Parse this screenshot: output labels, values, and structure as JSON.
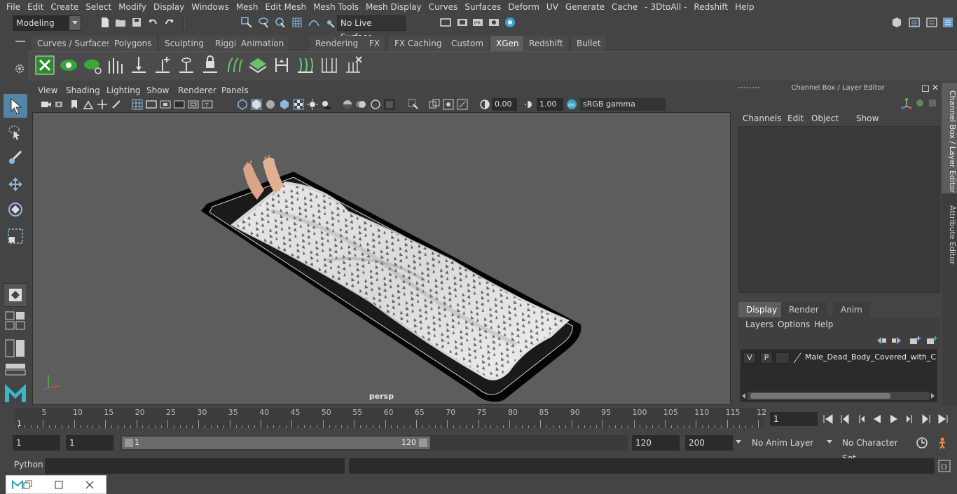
{
  "menu": [
    "File",
    "Edit",
    "Create",
    "Select",
    "Modify",
    "Display",
    "Windows",
    "Mesh",
    "Edit Mesh",
    "Mesh Tools",
    "Mesh Display",
    "Curves",
    "Surfaces",
    "Deform",
    "UV",
    "Generate",
    "Cache",
    "- 3DtoAll -",
    "Redshift",
    "Help"
  ],
  "status": {
    "mode": "Modeling",
    "live_surface": "No Live Surface"
  },
  "shelf_tabs": [
    "Curves / Surfaces",
    "Polygons",
    "Sculpting",
    "Rigging",
    "Animation",
    "Rendering",
    "FX",
    "FX Caching",
    "Custom",
    "XGen",
    "Redshift",
    "Bullet"
  ],
  "shelf_active": "XGen",
  "viewport": {
    "menus": [
      "View",
      "Shading",
      "Lighting",
      "Show",
      "Renderer",
      "Panels"
    ],
    "exposure": "0.00",
    "gamma": "1.00",
    "color_space": "sRGB gamma",
    "camera": "persp"
  },
  "channel_box": {
    "title": "Channel Box / Layer Editor",
    "menus": [
      "Channels",
      "Edit",
      "Object",
      "Show"
    ],
    "layer_tabs": [
      "Display",
      "Render",
      "Anim"
    ],
    "layer_menus": [
      "Layers",
      "Options",
      "Help"
    ],
    "layer": {
      "v": "V",
      "p": "P",
      "name": "Male_Dead_Body_Covered_with_Clot"
    }
  },
  "side_tabs": [
    "Channel Box / Layer Editor",
    "Attribute Editor"
  ],
  "timeline": {
    "ticks": [
      "5",
      "10",
      "15",
      "20",
      "25",
      "30",
      "35",
      "40",
      "45",
      "50",
      "55",
      "60",
      "65",
      "70",
      "75",
      "80",
      "85",
      "90",
      "95",
      "100",
      "105",
      "110",
      "115",
      "12"
    ],
    "start_marker": "1",
    "current_frame": "1"
  },
  "range": {
    "start": "1",
    "playback_start": "1",
    "slider_start": "1",
    "slider_end": "120",
    "playback_end": "120",
    "end": "200",
    "anim_layer": "No Anim Layer",
    "char_set": "No Character Set"
  },
  "cmd": {
    "label": "Python"
  }
}
